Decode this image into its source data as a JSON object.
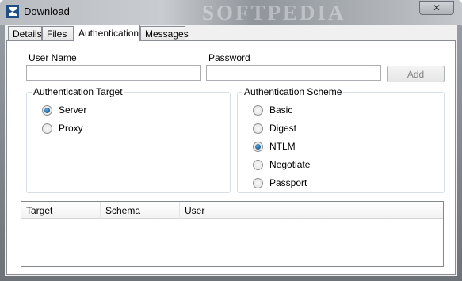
{
  "window": {
    "title": "Download",
    "watermark": "SOFTPEDIA",
    "close_label": "✕"
  },
  "tabs": [
    {
      "label": "Details"
    },
    {
      "label": "Files"
    },
    {
      "label": "Authentication"
    },
    {
      "label": "Messages"
    }
  ],
  "form": {
    "username_label": "User Name",
    "username_value": "",
    "password_label": "Password",
    "password_value": "",
    "add_label": "Add"
  },
  "auth_target": {
    "title": "Authentication Target",
    "options": [
      {
        "label": "Server",
        "checked": true
      },
      {
        "label": "Proxy",
        "checked": false
      }
    ]
  },
  "auth_scheme": {
    "title": "Authentication Scheme",
    "options": [
      {
        "label": "Basic",
        "checked": false
      },
      {
        "label": "Digest",
        "checked": false
      },
      {
        "label": "NTLM",
        "checked": true
      },
      {
        "label": "Negotiate",
        "checked": false
      },
      {
        "label": "Passport",
        "checked": false
      }
    ]
  },
  "list": {
    "columns": [
      "Target",
      "Schema",
      "User",
      ""
    ]
  }
}
